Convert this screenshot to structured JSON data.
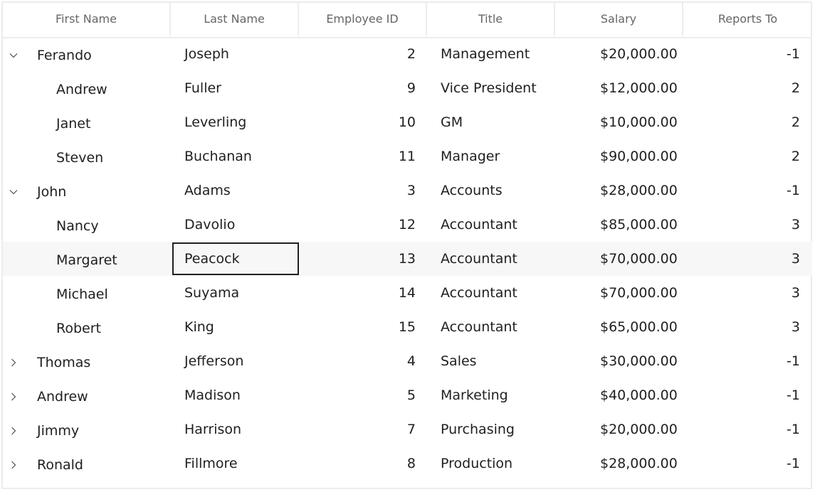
{
  "columns": [
    {
      "key": "first",
      "label": "First Name"
    },
    {
      "key": "last",
      "label": "Last Name"
    },
    {
      "key": "id",
      "label": "Employee ID"
    },
    {
      "key": "title",
      "label": "Title"
    },
    {
      "key": "salary",
      "label": "Salary"
    },
    {
      "key": "reports",
      "label": "Reports To"
    }
  ],
  "rows": [
    {
      "level": 0,
      "expander": "expanded",
      "first": "Ferando",
      "last": "Joseph",
      "id": "2",
      "title": "Management",
      "salary": "$20,000.00",
      "reports": "-1"
    },
    {
      "level": 1,
      "expander": "none",
      "first": "Andrew",
      "last": "Fuller",
      "id": "9",
      "title": "Vice President",
      "salary": "$12,000.00",
      "reports": "2"
    },
    {
      "level": 1,
      "expander": "none",
      "first": "Janet",
      "last": "Leverling",
      "id": "10",
      "title": "GM",
      "salary": "$10,000.00",
      "reports": "2"
    },
    {
      "level": 1,
      "expander": "none",
      "first": "Steven",
      "last": "Buchanan",
      "id": "11",
      "title": "Manager",
      "salary": "$90,000.00",
      "reports": "2"
    },
    {
      "level": 0,
      "expander": "expanded",
      "first": "John",
      "last": "Adams",
      "id": "3",
      "title": "Accounts",
      "salary": "$28,000.00",
      "reports": "-1"
    },
    {
      "level": 1,
      "expander": "none",
      "first": "Nancy",
      "last": "Davolio",
      "id": "12",
      "title": "Accountant",
      "salary": "$85,000.00",
      "reports": "3"
    },
    {
      "level": 1,
      "expander": "none",
      "first": "Margaret",
      "last": "Peacock",
      "id": "13",
      "title": "Accountant",
      "salary": "$70,000.00",
      "reports": "3",
      "hover": true,
      "selected_cell": "last"
    },
    {
      "level": 1,
      "expander": "none",
      "first": "Michael",
      "last": "Suyama",
      "id": "14",
      "title": "Accountant",
      "salary": "$70,000.00",
      "reports": "3"
    },
    {
      "level": 1,
      "expander": "none",
      "first": "Robert",
      "last": "King",
      "id": "15",
      "title": "Accountant",
      "salary": "$65,000.00",
      "reports": "3"
    },
    {
      "level": 0,
      "expander": "collapsed",
      "first": "Thomas",
      "last": "Jefferson",
      "id": "4",
      "title": "Sales",
      "salary": "$30,000.00",
      "reports": "-1"
    },
    {
      "level": 0,
      "expander": "collapsed",
      "first": "Andrew",
      "last": "Madison",
      "id": "5",
      "title": "Marketing",
      "salary": "$40,000.00",
      "reports": "-1"
    },
    {
      "level": 0,
      "expander": "collapsed",
      "first": "Jimmy",
      "last": "Harrison",
      "id": "7",
      "title": "Purchasing",
      "salary": "$20,000.00",
      "reports": "-1"
    },
    {
      "level": 0,
      "expander": "collapsed",
      "first": "Ronald",
      "last": "Fillmore",
      "id": "8",
      "title": "Production",
      "salary": "$28,000.00",
      "reports": "-1"
    }
  ],
  "icons": {
    "expanded": "chevron-down-icon",
    "collapsed": "chevron-right-icon"
  },
  "colors": {
    "hover_row": "#f7f7f7",
    "border": "#ececec",
    "header_text": "#666666",
    "cell_text": "#1f1f1f",
    "focus_border": "#202020"
  }
}
